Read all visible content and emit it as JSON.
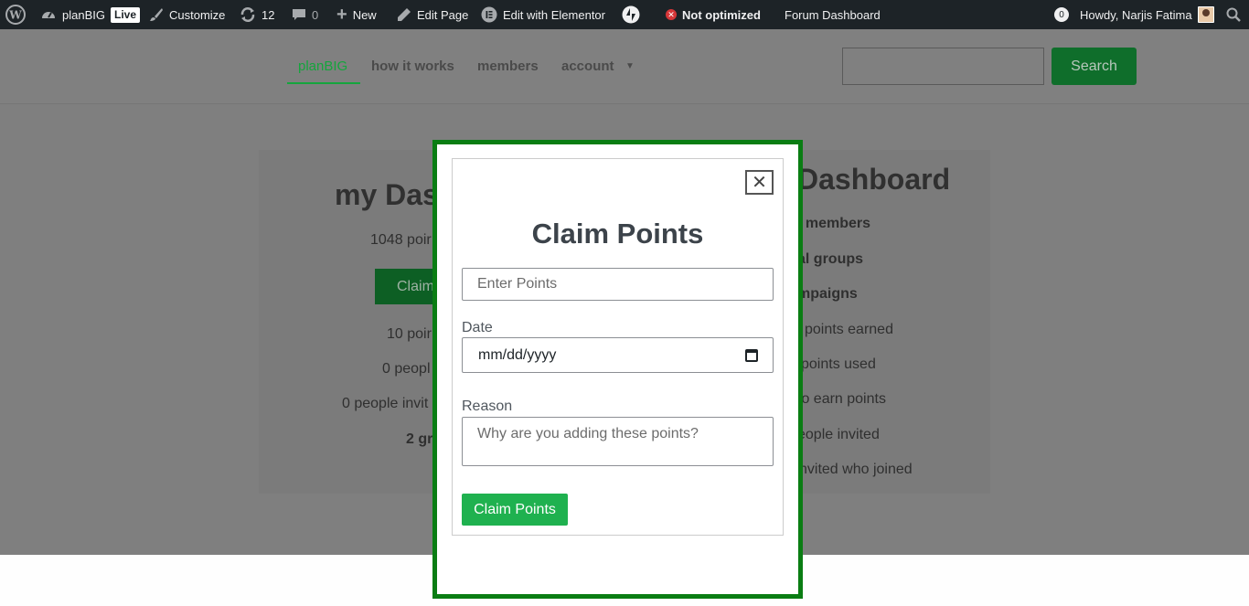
{
  "admin_bar": {
    "site_name": "planBIG",
    "live_badge": "Live",
    "customize": "Customize",
    "updates_count": "12",
    "comments_count": "0",
    "new": "New",
    "edit_page": "Edit Page",
    "edit_elementor": "Edit with Elementor",
    "not_optimized": "Not optimized",
    "forum_dashboard": "Forum Dashboard",
    "notif_count": "0",
    "howdy": "Howdy, Narjis Fatima"
  },
  "nav": {
    "items": [
      {
        "label": "planBIG"
      },
      {
        "label": "how it works"
      },
      {
        "label": "members"
      },
      {
        "label": "account"
      }
    ],
    "search_button": "Search"
  },
  "background": {
    "left_title": "my Das",
    "left_points": "1048 poir",
    "left_claim": "Claim",
    "left_line1": "10 poir",
    "left_line2": "0 peopl",
    "left_line3": "0 people invit",
    "left_line4": "2 gr",
    "right_title": "Dashboard",
    "right_line1": "l members",
    "right_line2": "al groups",
    "right_line3": "mpaigns",
    "right_line4": "l points earned",
    "right_line5": "points used",
    "right_line6": "to earn points",
    "right_line7": "eople invited",
    "right_line8": "nvited who joined"
  },
  "modal": {
    "close_symbol": "✕",
    "title": "Claim Points",
    "points_placeholder": "Enter Points",
    "date_label": "Date",
    "date_value": "mm/dd/yyyy",
    "reason_label": "Reason",
    "reason_placeholder": "Why are you adding these points?",
    "submit": "Claim Points"
  },
  "colors": {
    "admin_bar": "#1d2327",
    "accent_green": "#1fb14f",
    "modal_border": "#0a7d13",
    "overlay": "#7f7f7f"
  },
  "icons": [
    "wordpress-logo-icon",
    "dashboard-icon",
    "brush-icon",
    "updates-icon",
    "comment-icon",
    "plus-icon",
    "pencil-icon",
    "elementor-icon",
    "jetpack-icon",
    "error-icon",
    "search-icon",
    "calendar-icon",
    "close-icon"
  ]
}
